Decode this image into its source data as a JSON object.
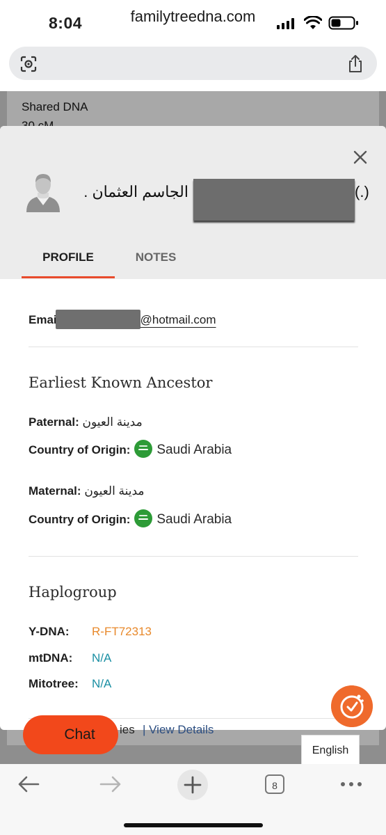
{
  "status_bar": {
    "time": "8:04"
  },
  "browser": {
    "url": "familytreedna.com"
  },
  "background_page": {
    "shared_dna_label": "Shared DNA",
    "shared_dna_value": "30 cM",
    "view_details": "| View Details",
    "partial_label": "ies"
  },
  "modal": {
    "member_name": "الجاسم العثمان .",
    "name_suffix": "(.)",
    "tabs": [
      {
        "label": "PROFILE",
        "active": true
      },
      {
        "label": "NOTES",
        "active": false
      }
    ],
    "email": {
      "label": "Emai",
      "domain": "@hotmail.com"
    },
    "ancestor": {
      "title": "Earliest Known Ancestor",
      "paternal_label": "Paternal:",
      "paternal_value": "مدينة العيون",
      "paternal_country_label": "Country of Origin:",
      "paternal_country": "Saudi Arabia",
      "maternal_label": "Maternal:",
      "maternal_value": "مدينة العيون",
      "maternal_country_label": "Country of Origin:",
      "maternal_country": "Saudi Arabia"
    },
    "haplogroup": {
      "title": "Haplogroup",
      "rows": [
        {
          "label": "Y-DNA:",
          "value": "R-FT72313",
          "color": "#e8892b"
        },
        {
          "label": "mtDNA:",
          "value": "N/A",
          "color": "#1a8fa3"
        },
        {
          "label": "Mitotree:",
          "value": "N/A",
          "color": "#1a8fa3"
        }
      ]
    }
  },
  "chat_label": "Chat",
  "language": "English",
  "toolbar": {
    "tab_count": "8"
  },
  "colors": {
    "accent": "#e84b2c",
    "chat": "#f2481b",
    "ydna": "#e8892b",
    "na": "#1a8fa3",
    "flag": "#2d9b37"
  }
}
